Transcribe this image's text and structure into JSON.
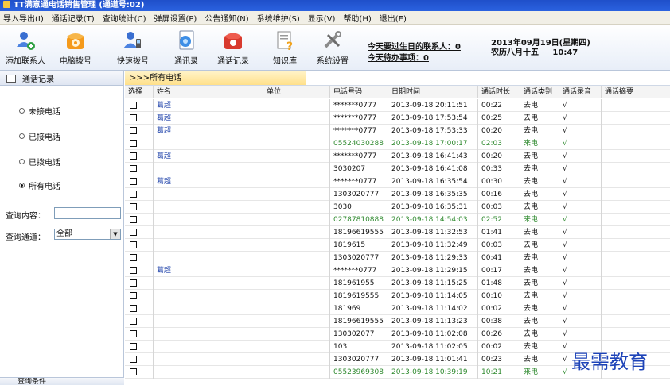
{
  "window": {
    "title": "TT满意通电话销售管理 (通道号:02)"
  },
  "menu": [
    "导入导出(I)",
    "通话记录(T)",
    "查询统计(C)",
    "弹屏设置(P)",
    "公告通知(N)",
    "系统维护(S)",
    "显示(V)",
    "帮助(H)",
    "退出(E)"
  ],
  "toolbar": {
    "buttons": [
      {
        "label": "添加联系人",
        "icon": "add-contact-icon"
      },
      {
        "label": "电脑拨号",
        "icon": "phone-dial-icon"
      },
      {
        "label": "快速拨号",
        "icon": "speed-dial-icon"
      },
      {
        "label": "通讯录",
        "icon": "address-book-icon"
      },
      {
        "label": "通话记录",
        "icon": "call-record-icon"
      },
      {
        "label": "知识库",
        "icon": "knowledge-base-icon"
      },
      {
        "label": "系统设置",
        "icon": "settings-icon"
      }
    ],
    "birthday_reminder": "今天要过生日的联系人：0",
    "todo_reminder": "今天待办事项：0",
    "date_line": "2013年09月19日(星期四)",
    "lunar_line": "农历八月十五     10:47"
  },
  "left_panel": {
    "header": "通话记录",
    "filters": [
      {
        "label": "未接电话",
        "selected": false
      },
      {
        "label": "已接电话",
        "selected": false
      },
      {
        "label": "已拨电话",
        "selected": false
      },
      {
        "label": "所有电话",
        "selected": true
      }
    ],
    "search_label": "查询内容：",
    "search_value": "",
    "channel_label": "查询通道：",
    "channel_value": "全部",
    "bottom_tab": "查询条件"
  },
  "main": {
    "breadcrumb": ">>>所有电话",
    "columns": [
      "选择",
      "姓名",
      "单位",
      "电话号码",
      "日期时间",
      "通话时长",
      "通话类别",
      "通话录音",
      "通话摘要"
    ],
    "rows": [
      {
        "name": "葛超",
        "unit": "",
        "phone": "*******0777",
        "datetime": "2013-09-18 20:11:51",
        "duration": "00:22",
        "type": "去电",
        "recording": "√",
        "summary": "",
        "incoming": false
      },
      {
        "name": "葛超",
        "unit": "",
        "phone": "*******0777",
        "datetime": "2013-09-18 17:53:54",
        "duration": "00:25",
        "type": "去电",
        "recording": "√",
        "summary": "",
        "incoming": false
      },
      {
        "name": "葛超",
        "unit": "",
        "phone": "*******0777",
        "datetime": "2013-09-18 17:53:33",
        "duration": "00:20",
        "type": "去电",
        "recording": "√",
        "summary": "",
        "incoming": false
      },
      {
        "name": "",
        "unit": "",
        "phone": "05524030288",
        "datetime": "2013-09-18 17:00:17",
        "duration": "02:03",
        "type": "来电",
        "recording": "√",
        "summary": "",
        "incoming": true
      },
      {
        "name": "葛超",
        "unit": "",
        "phone": "*******0777",
        "datetime": "2013-09-18 16:41:43",
        "duration": "00:20",
        "type": "去电",
        "recording": "√",
        "summary": "",
        "incoming": false
      },
      {
        "name": "",
        "unit": "",
        "phone": "3030207",
        "datetime": "2013-09-18 16:41:08",
        "duration": "00:33",
        "type": "去电",
        "recording": "√",
        "summary": "",
        "incoming": false
      },
      {
        "name": "葛超",
        "unit": "",
        "phone": "*******0777",
        "datetime": "2013-09-18 16:35:54",
        "duration": "00:30",
        "type": "去电",
        "recording": "√",
        "summary": "",
        "incoming": false
      },
      {
        "name": "",
        "unit": "",
        "phone": "1303020777",
        "datetime": "2013-09-18 16:35:35",
        "duration": "00:16",
        "type": "去电",
        "recording": "√",
        "summary": "",
        "incoming": false
      },
      {
        "name": "",
        "unit": "",
        "phone": "3030",
        "datetime": "2013-09-18 16:35:31",
        "duration": "00:03",
        "type": "去电",
        "recording": "√",
        "summary": "",
        "incoming": false
      },
      {
        "name": "",
        "unit": "",
        "phone": "02787810888",
        "datetime": "2013-09-18 14:54:03",
        "duration": "02:52",
        "type": "来电",
        "recording": "√",
        "summary": "",
        "incoming": true
      },
      {
        "name": "",
        "unit": "",
        "phone": "18196619555",
        "datetime": "2013-09-18 11:32:53",
        "duration": "01:41",
        "type": "去电",
        "recording": "√",
        "summary": "",
        "incoming": false
      },
      {
        "name": "",
        "unit": "",
        "phone": "1819615",
        "datetime": "2013-09-18 11:32:49",
        "duration": "00:03",
        "type": "去电",
        "recording": "√",
        "summary": "",
        "incoming": false
      },
      {
        "name": "",
        "unit": "",
        "phone": "1303020777",
        "datetime": "2013-09-18 11:29:33",
        "duration": "00:41",
        "type": "去电",
        "recording": "√",
        "summary": "",
        "incoming": false
      },
      {
        "name": "葛超",
        "unit": "",
        "phone": "*******0777",
        "datetime": "2013-09-18 11:29:15",
        "duration": "00:17",
        "type": "去电",
        "recording": "√",
        "summary": "",
        "incoming": false
      },
      {
        "name": "",
        "unit": "",
        "phone": "181961955",
        "datetime": "2013-09-18 11:15:25",
        "duration": "01:48",
        "type": "去电",
        "recording": "√",
        "summary": "",
        "incoming": false
      },
      {
        "name": "",
        "unit": "",
        "phone": "1819619555",
        "datetime": "2013-09-18 11:14:05",
        "duration": "00:10",
        "type": "去电",
        "recording": "√",
        "summary": "",
        "incoming": false
      },
      {
        "name": "",
        "unit": "",
        "phone": "181969",
        "datetime": "2013-09-18 11:14:02",
        "duration": "00:02",
        "type": "去电",
        "recording": "√",
        "summary": "",
        "incoming": false
      },
      {
        "name": "",
        "unit": "",
        "phone": "18196619555",
        "datetime": "2013-09-18 11:13:23",
        "duration": "00:38",
        "type": "去电",
        "recording": "√",
        "summary": "",
        "incoming": false
      },
      {
        "name": "",
        "unit": "",
        "phone": "130302077",
        "datetime": "2013-09-18 11:02:08",
        "duration": "00:26",
        "type": "去电",
        "recording": "√",
        "summary": "",
        "incoming": false
      },
      {
        "name": "",
        "unit": "",
        "phone": "103",
        "datetime": "2013-09-18 11:02:05",
        "duration": "00:02",
        "type": "去电",
        "recording": "√",
        "summary": "",
        "incoming": false
      },
      {
        "name": "",
        "unit": "",
        "phone": "1303020777",
        "datetime": "2013-09-18 11:01:41",
        "duration": "00:23",
        "type": "去电",
        "recording": "√",
        "summary": "",
        "incoming": false
      },
      {
        "name": "",
        "unit": "",
        "phone": "05523969308",
        "datetime": "2013-09-18 10:39:19",
        "duration": "10:21",
        "type": "来电",
        "recording": "√",
        "summary": "",
        "incoming": true
      }
    ]
  },
  "watermark": "最需教育",
  "colors": {
    "incoming": "#2f8a2f",
    "name_link": "#1b3fa8",
    "title_bar": "#2458d6"
  }
}
